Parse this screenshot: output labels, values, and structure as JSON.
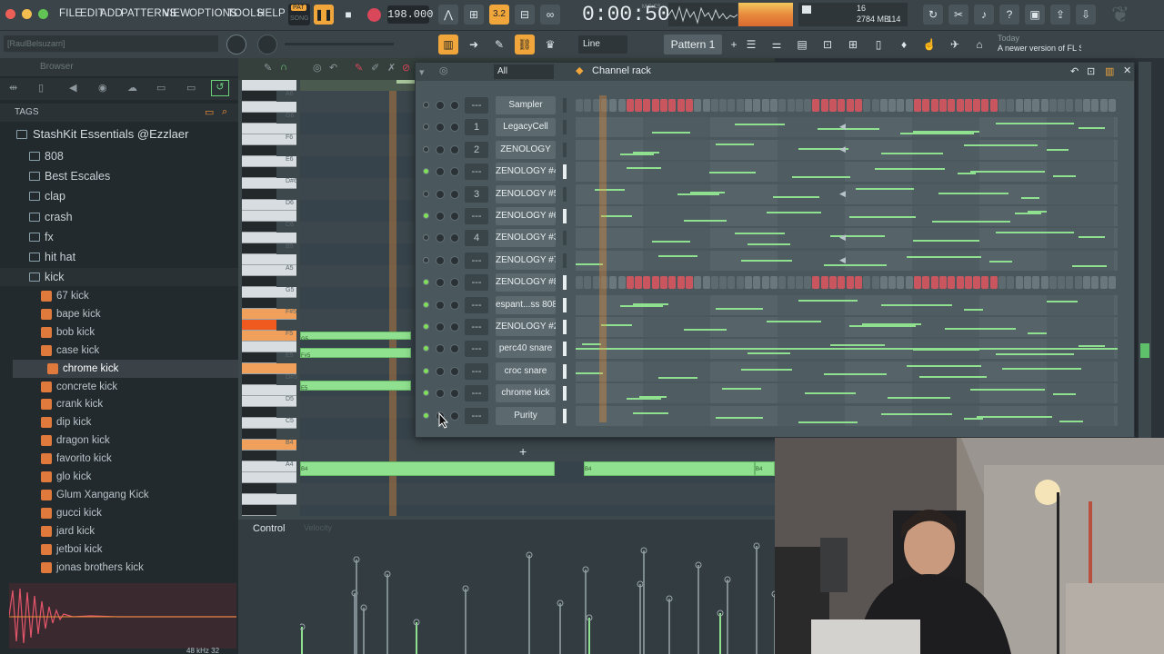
{
  "menu": {
    "file": "FILE",
    "edit": "EDIT",
    "add": "ADD",
    "patterns": "PATTERNS",
    "view": "VIEW",
    "options": "OPTIONS",
    "tools": "TOOLS",
    "help": "HELP"
  },
  "transport": {
    "pat_label": "PAT",
    "song_label": "SONG",
    "tempo": "198.000",
    "time": "0:00:50",
    "time_unit": "M:S:CS",
    "cpu": "16",
    "memory": "2784 MB",
    "voices": "114"
  },
  "toolbar": {
    "snap": "Line",
    "pattern": "Pattern 1",
    "news_date": "Today",
    "news_text": "A newer version of FL Studio i..."
  },
  "browser": {
    "user": "[RaulBelsuzarri]",
    "title": "Browser",
    "tags": "TAGS",
    "root": "StashKit Essentials @Ezzlaer",
    "folders": [
      "808",
      "Best Escales",
      "clap",
      "crash",
      "fx",
      "hit hat",
      "kick"
    ],
    "kicks": [
      "67 kick",
      "bape kick",
      "bob kick",
      "case kick",
      "chrome kick",
      "concrete kick",
      "crank kick",
      "dip kick",
      "dragon kick",
      "favorito kick",
      "glo kick",
      "Glum Xangang Kick",
      "gucci kick",
      "jard kick",
      "jetboi kick",
      "jonas brothers kick"
    ],
    "sample_info": "48 kHz 32"
  },
  "piano": {
    "keys": [
      "A6",
      "G6",
      "F6",
      "E6",
      "D#6",
      "D6",
      "C6",
      "B5",
      "A5",
      "G5",
      "F#5",
      "F5",
      "E5",
      "D#5",
      "D5",
      "C5",
      "B4",
      "A4"
    ],
    "note_labels": [
      "G5",
      "F#5",
      "E5",
      "B4",
      "B4",
      "B4"
    ]
  },
  "rack": {
    "title": "Channel rack",
    "filter": "All",
    "channels": [
      {
        "name": "Sampler",
        "route": "---",
        "led": false,
        "mode": "steps"
      },
      {
        "name": "LegacyCell",
        "route": "1",
        "led": false,
        "mode": "notes"
      },
      {
        "name": "ZENOLOGY",
        "route": "2",
        "led": false,
        "mode": "notes"
      },
      {
        "name": "ZENOLOGY #4",
        "route": "---",
        "led": true,
        "mode": "notes"
      },
      {
        "name": "ZENOLOGY #5",
        "route": "3",
        "led": false,
        "mode": "notes"
      },
      {
        "name": "ZENOLOGY #6",
        "route": "---",
        "led": true,
        "mode": "notes"
      },
      {
        "name": "ZENOLOGY #3",
        "route": "4",
        "led": false,
        "mode": "notes"
      },
      {
        "name": "ZENOLOGY #7",
        "route": "---",
        "led": false,
        "mode": "notes"
      },
      {
        "name": "ZENOLOGY #8",
        "route": "---",
        "led": true,
        "mode": "steps"
      },
      {
        "name": "espant...ss 808",
        "route": "---",
        "led": true,
        "mode": "notes"
      },
      {
        "name": "ZENOLOGY #2",
        "route": "---",
        "led": true,
        "mode": "notes"
      },
      {
        "name": "perc40 snare",
        "route": "---",
        "led": true,
        "mode": "notes"
      },
      {
        "name": "croc snare",
        "route": "---",
        "led": true,
        "mode": "notes"
      },
      {
        "name": "chrome kick",
        "route": "---",
        "led": true,
        "mode": "notes"
      },
      {
        "name": "Purity",
        "route": "---",
        "led": true,
        "mode": "notes"
      }
    ]
  },
  "control": {
    "label": "Control",
    "value": "Velocity"
  },
  "colors": {
    "accent": "#f0923a",
    "note": "#8fe08f",
    "led_on": "#7fe05a",
    "step_red": "#c9565f"
  }
}
